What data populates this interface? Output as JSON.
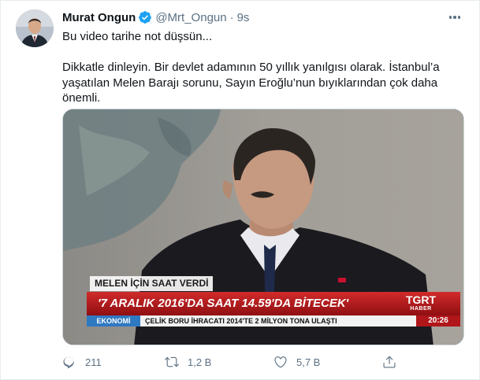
{
  "author": {
    "name": "Murat Ongun",
    "handle": "@Mrt_Ongun",
    "separator": "·",
    "time": "9s"
  },
  "tweet": {
    "paragraphs": [
      "Bu video tarihe not düşsün...",
      "Dikkatle dinleyin. Bir devlet adamının 50 yıllık yanılgısı olarak. İstanbul’a yaşatılan Melen Barajı sorunu, Sayın Eroğlu’nun bıyıklarından çok daha önemli."
    ]
  },
  "video": {
    "lower_third_label": "MELEN İÇİN SAAT VERDİ",
    "headline": "'7 ARALIK 2016'DA SAAT 14.59'DA BİTECEK'",
    "channel": "TGRT",
    "channel_sub": "HABER",
    "ticker_section": "EKONOMİ",
    "ticker_text": "ÇELİK BORU İHRACATI 2014'TE 2 MİLYON TONA ULAŞTI",
    "clock": "20:26"
  },
  "actions": {
    "reply_count": "211",
    "retweet_count": "1,2 B",
    "like_count": "5,7 B"
  },
  "colors": {
    "text_primary": "#0f1419",
    "text_secondary": "#5b7083",
    "verified": "#1da1f2",
    "border": "#e6ecf0"
  },
  "icons": {
    "verified": "verified-badge-icon",
    "more": "more-options-icon",
    "reply": "reply-icon",
    "retweet": "retweet-icon",
    "like": "heart-icon",
    "share": "share-icon"
  }
}
